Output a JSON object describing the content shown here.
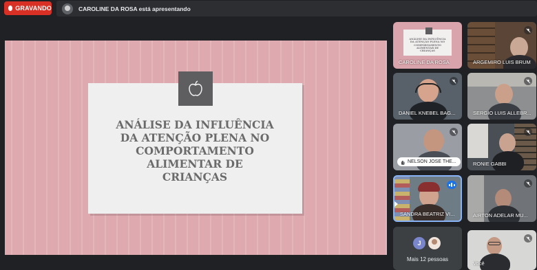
{
  "recording": {
    "label": "GRAVANDO",
    "color": "#d93025"
  },
  "presentation_bar": {
    "text": "CAROLINE DA ROSA está apresentando",
    "avatar_icon": "user-avatar-icon"
  },
  "slide": {
    "title_lines": [
      "ANÁLISE DA INFLUÊNCIA",
      "DA ATENÇÃO PLENA NO",
      "COMPORTAMENTO",
      "ALIMENTAR DE",
      "CRIANÇAS"
    ],
    "icon": "apple-icon",
    "background_color": "#deaab0"
  },
  "participants": [
    {
      "name": "CAROLINE DA ROSA",
      "muted": false,
      "presenting": true
    },
    {
      "name": "ARGEMIRO LUIS BRUM",
      "muted": true
    },
    {
      "name": "DANIEL KNEBEL BAG...",
      "muted": true
    },
    {
      "name": "SERGIO LUIS ALLEBR...",
      "muted": true
    },
    {
      "name": "NELSON JOSÉ THE...",
      "muted": true,
      "hand_raised": true
    },
    {
      "name": "RONIE GABBI",
      "muted": true
    },
    {
      "name": "SANDRA BEATRIZ VI...",
      "muted": false,
      "speaking": true
    },
    {
      "name": "AIRTON ADELAR MU...",
      "muted": true
    },
    {
      "name": "Você",
      "muted": true
    }
  ],
  "more_people": {
    "label": "Mais 12 pessoas",
    "initial": "J"
  }
}
